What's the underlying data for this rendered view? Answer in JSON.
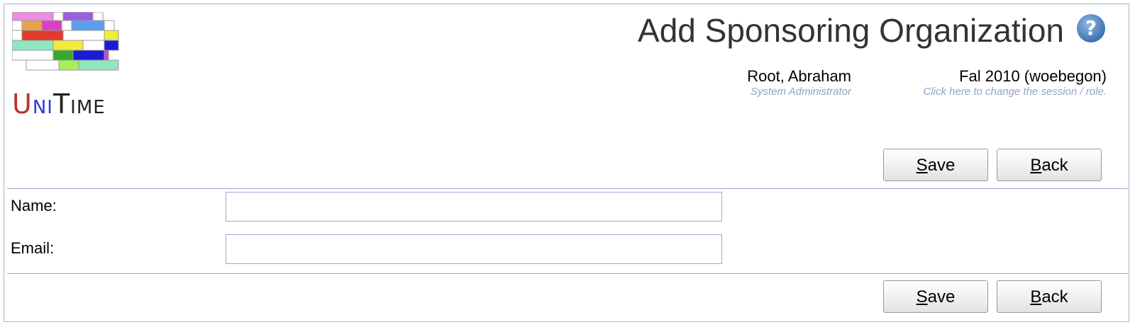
{
  "logo": {
    "text_u": "U",
    "text_ni": "NI",
    "text_t": "T",
    "text_ime": "IME"
  },
  "header": {
    "title": "Add Sponsoring Organization",
    "help_icon": "question-mark-icon",
    "user_name": "Root, Abraham",
    "user_role": "System Administrator",
    "session_name": "Fal 2010 (woebegon)",
    "session_hint": "Click here to change the session / role."
  },
  "buttons": {
    "save_rest": "ave",
    "save_key": "S",
    "back_rest": "ack",
    "back_key": "B"
  },
  "form": {
    "name_label": "Name:",
    "name_value": "",
    "email_label": "Email:",
    "email_value": ""
  },
  "colors": {
    "accent": "#3f74b0",
    "border": "#9aa7c2",
    "hint": "#8ea2c8"
  }
}
